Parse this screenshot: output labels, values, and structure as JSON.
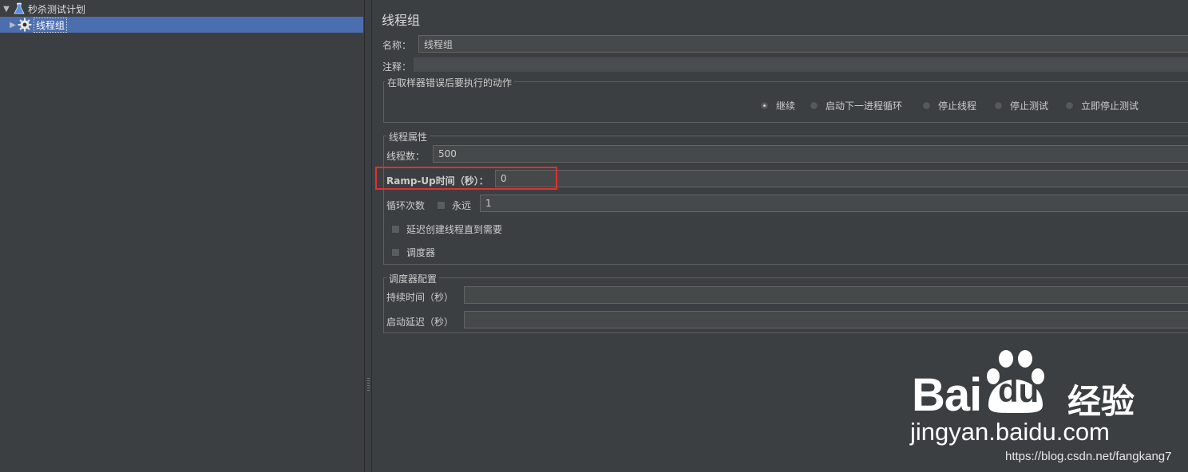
{
  "tree": {
    "root_label": "秒杀测试计划",
    "child_label": "线程组"
  },
  "panel": {
    "title": "线程组",
    "name_label": "名称：",
    "name_value": "线程组",
    "comment_label": "注释：",
    "comment_value": ""
  },
  "error_action": {
    "legend": "在取样器错误后要执行的动作",
    "options": [
      {
        "label": "继续",
        "selected": true
      },
      {
        "label": "启动下一进程循环",
        "selected": false
      },
      {
        "label": "停止线程",
        "selected": false
      },
      {
        "label": "停止测试",
        "selected": false
      },
      {
        "label": "立即停止测试",
        "selected": false
      }
    ]
  },
  "thread_props": {
    "legend": "线程属性",
    "threads_label": "线程数：",
    "threads_value": "500",
    "rampup_label": "Ramp-Up时间（秒）：",
    "rampup_value": "0",
    "loop_label": "循环次数",
    "forever_label": "永远",
    "forever_checked": false,
    "loop_value": "1",
    "delay_label": "延迟创建线程直到需要",
    "delay_checked": false,
    "scheduler_label": "调度器",
    "scheduler_checked": false
  },
  "scheduler_config": {
    "legend": "调度器配置",
    "duration_label": "持续时间（秒）",
    "duration_value": "",
    "startup_delay_label": "启动延迟（秒）",
    "startup_delay_value": ""
  },
  "watermark": {
    "bai": "Bai",
    "du": "du",
    "jingyan": "经验",
    "url": "jingyan.baidu.com",
    "csdn": "https://blog.csdn.net/fangkang7"
  },
  "colors": {
    "background": "#3c3f41",
    "selection": "#4b6eaf",
    "highlight_box": "#e03131"
  }
}
